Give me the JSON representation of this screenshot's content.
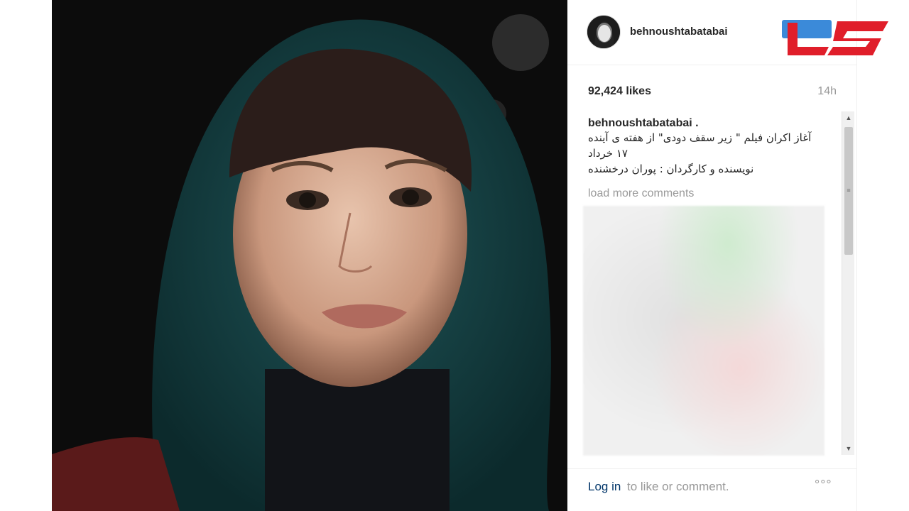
{
  "post": {
    "username": "behnoushtabatabai",
    "likes": "92,424 likes",
    "time": "14h",
    "caption_user": "behnoushtabatabai .",
    "caption_lines": [
      "آغاز اکران فیلم \" زیر سقف دودی\" از هفته ی آینده",
      "۱۷ خرداد",
      "نویسنده و کارگردان : پوران درخشنده"
    ],
    "load_more": "load more comments",
    "login_link": "Log in",
    "login_rest": "to like or comment.",
    "more": "°°°"
  },
  "icons": {
    "scroll_up": "▲",
    "scroll_down": "▼",
    "scroll_grip": "≡"
  },
  "colors": {
    "link": "#003569",
    "muted": "#999999",
    "logo_red": "#e01e2a",
    "logo_blue": "#1976d2"
  }
}
